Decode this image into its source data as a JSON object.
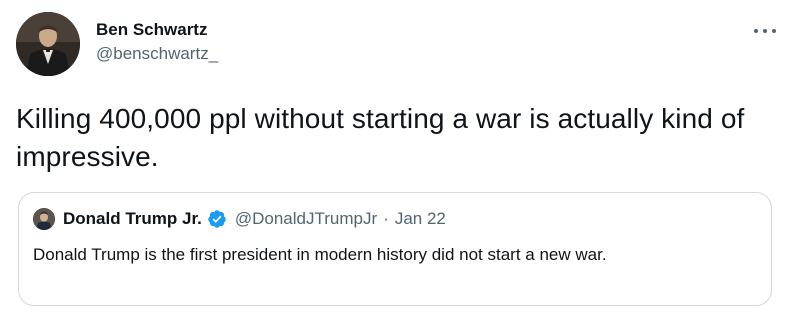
{
  "tweet": {
    "author_name": "Ben Schwartz",
    "author_handle": "@benschwartz_",
    "text": "Killing 400,000 ppl without starting a war is actually kind of impressive."
  },
  "quoted_tweet": {
    "author_name": "Donald Trump Jr.",
    "author_handle": "@DonaldJTrumpJr",
    "separator": "·",
    "date": "Jan 22",
    "text": "Donald Trump is the first president in modern history did not start a new war."
  },
  "icons": {
    "more": "more-dots-icon",
    "verified": "verified-badge-icon"
  },
  "colors": {
    "text_primary": "#0f1419",
    "text_secondary": "#536471",
    "border": "#cfd9de",
    "verified": "#1d9bf0"
  }
}
